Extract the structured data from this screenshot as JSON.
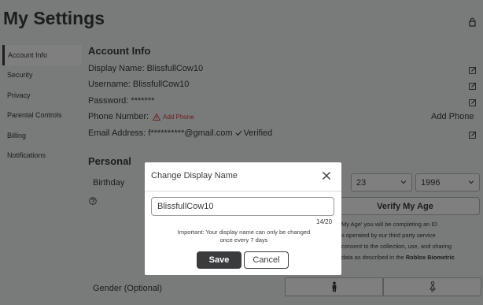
{
  "page": {
    "title": "My Settings"
  },
  "sidebar": {
    "items": [
      {
        "label": "Account Info"
      },
      {
        "label": "Security"
      },
      {
        "label": "Privacy"
      },
      {
        "label": "Parental Controls"
      },
      {
        "label": "Billing"
      },
      {
        "label": "Notifications"
      }
    ]
  },
  "account": {
    "title": "Account Info",
    "display_name": "Display Name: BlissfullCow10",
    "username": "Username: BlissfullCow10",
    "password": "Password: *******",
    "phone_label": "Phone Number:",
    "phone_warning": "Add Phone",
    "add_phone": "Add Phone",
    "email": "Email Address: f**********@gmail.com",
    "verified": "Verified"
  },
  "personal": {
    "title": "Personal",
    "birthday_label": "Birthday",
    "day": "23",
    "year": "1996",
    "verify_label": "Verify My Age",
    "note_line1": "My Age' you will be completing an ID",
    "note_line2": "s operated by our third party service",
    "note_line3": "consent to the collection, use, and sharing",
    "note_line4_a": "data as described in the ",
    "note_line4_b": "Roblox Biometric",
    "gender_label": "Gender (Optional)"
  },
  "modal": {
    "title": "Change Display Name",
    "input_value": "BlissfullCow10",
    "char_count": "14/20",
    "important_line1": "Important: Your display name can only be changed",
    "important_line2": "once every 7 days",
    "save_label": "Save",
    "cancel_label": "Cancel"
  },
  "colors": {
    "warning": "#d63f3f",
    "primary_button": "#393b3d",
    "overlay": "rgba(0,0,0,0.5)"
  },
  "icons": [
    "lock-icon",
    "edit-icon",
    "warning-icon",
    "check-icon",
    "question-icon",
    "chevron-down-icon",
    "male-icon",
    "female-icon",
    "close-icon"
  ]
}
